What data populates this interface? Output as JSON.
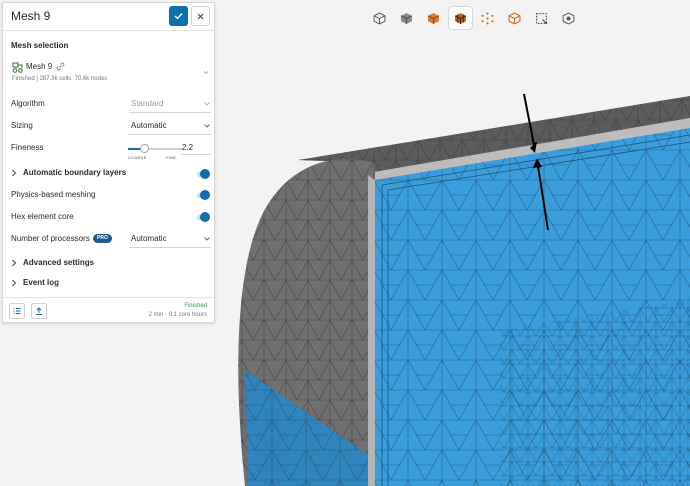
{
  "panel": {
    "title": "Mesh 9",
    "mesh_selection": {
      "heading": "Mesh selection",
      "mesh_name": "Mesh 9",
      "status": "Finished | 287.3k cells, 70.6k nodes"
    },
    "algorithm": {
      "label": "Algorithm",
      "value": "Standard"
    },
    "sizing": {
      "label": "Sizing",
      "value": "Automatic"
    },
    "fineness": {
      "label": "Fineness",
      "value": "2.2",
      "min_label": "COARSE",
      "max_label": "FINE",
      "level": 0.3
    },
    "auto_boundary_layers": {
      "label": "Automatic boundary layers",
      "enabled": true
    },
    "physics_based_meshing": {
      "label": "Physics-based meshing",
      "enabled": true
    },
    "hex_element_core": {
      "label": "Hex element core",
      "enabled": true
    },
    "processors": {
      "label": "Number of processors",
      "badge": "PRO",
      "value": "Automatic"
    },
    "advanced_settings": {
      "label": "Advanced settings"
    },
    "event_log": {
      "label": "Event log"
    },
    "footer": {
      "status": "Finished",
      "time": "2 min - 0.1 core hours"
    }
  },
  "view_toolbar": {
    "buttons": [
      {
        "icon": "cube-outline-icon",
        "active": false
      },
      {
        "icon": "cube-solid-icon",
        "active": false
      },
      {
        "icon": "cube-orange-icon",
        "active": false
      },
      {
        "icon": "cube-orange-dark-icon",
        "active": true
      },
      {
        "icon": "cube-points-icon",
        "active": false
      },
      {
        "icon": "cube-wire-orange-icon",
        "active": false
      },
      {
        "icon": "box-select-icon",
        "active": false
      },
      {
        "icon": "cube-settings-icon",
        "active": false
      }
    ]
  },
  "colors": {
    "accent": "#0c6fb0",
    "mesh_blue": "#3a9edc",
    "mesh_gray": "#6e6e6e",
    "success": "#2a9a3e"
  }
}
